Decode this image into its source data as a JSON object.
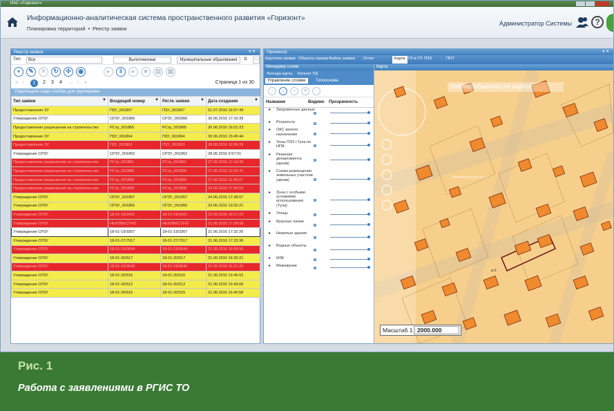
{
  "window": {
    "title": "ИАС «Горизонт»"
  },
  "header": {
    "title": "Информационно-аналитическая система пространственного развития «Горизонт»",
    "breadcrumb": [
      "Планировка территорий",
      "Реестр заявок"
    ],
    "user": "Администратор Системы"
  },
  "left_panel": {
    "title": "Реестр заявок",
    "filter_label": "Тип:",
    "filter_value": "Все",
    "done_button": "Выполненные",
    "mun_button": "Муниципальные образования",
    "pages": [
      "1",
      "2",
      "3",
      "4"
    ],
    "page_info": "Страница 1 из 30",
    "group_hint": "Перетащите сюда столбец для группировки",
    "columns": [
      "Тип заявки",
      "Входящий номер",
      "Рег.№ заявки",
      "Дата создания"
    ],
    "rows": [
      {
        "color": "yellow",
        "cells": [
          "Предоставление ЗУ",
          "П3У_001867",
          "П3У_001867",
          "01.07.2016 16:57:49"
        ]
      },
      {
        "color": "white",
        "cells": [
          "Утверждение СРЗУ",
          "СРЗУ_001866",
          "СРЗУ_001866",
          "30.06.2016 17:16:39"
        ]
      },
      {
        "color": "yellow",
        "cells": [
          "Предоставление разрешения на строительство",
          "РСтр_001865",
          "РСтр_001865",
          "30.06.2016 16:01:23"
        ]
      },
      {
        "color": "yellow",
        "cells": [
          "Предоставление ЗУ",
          "П3У_001864",
          "П3У_001864",
          "30.06.2016 15:45:44"
        ]
      },
      {
        "color": "red",
        "cells": [
          "Предоставление ЗУ",
          "П3У_001863",
          "П3У_001863",
          "28.06.2016 12:56:29"
        ]
      },
      {
        "color": "white",
        "cells": [
          "Утверждение СРЗУ",
          "СРЗУ_001862",
          "СРЗУ_001862",
          "28.06.2016 9:57:01"
        ]
      },
      {
        "color": "red",
        "cells": [
          "Предоставление разрешения на строительство",
          "РСтр_001861",
          "РСтр_001861",
          "27.06.2016 17:14:33"
        ]
      },
      {
        "color": "red",
        "cells": [
          "Предоставление разрешения на строительство",
          "РСтр_001860",
          "РСтр_001860",
          "27.06.2016 12:52:41"
        ]
      },
      {
        "color": "red",
        "cells": [
          "Предоставление разрешения на строительство",
          "РСтр_001859",
          "РСтр_001859",
          "27.06.2016 11:29:37"
        ]
      },
      {
        "color": "red",
        "cells": [
          "Предоставление разрешения на строительство",
          "РСтр_001858",
          "РСтр_001858",
          "24.06.2016 17:30:03"
        ]
      },
      {
        "color": "yellow",
        "cells": [
          "Утверждение СРЗУ",
          "СРЗУ_001857",
          "СРЗУ_001857",
          "24.06.2016 17:28:07"
        ]
      },
      {
        "color": "yellow",
        "cells": [
          "Утверждение СРЗУ",
          "СРЗУ_001855",
          "СРЗУ_001855",
          "23.06.2016 19:32:21"
        ]
      },
      {
        "color": "red",
        "cells": [
          "Утверждение СРЗУ",
          "18-01-19/3421",
          "18-01-19/3421",
          "22.06.2016 18:17:23"
        ]
      },
      {
        "color": "red",
        "cells": [
          "Утверждение СРЗУ",
          "НЕИЗВЕСТНО",
          "НЕИЗВЕСТНО",
          "21.06.2016 17:39:08"
        ]
      },
      {
        "color": "selected",
        "cells": [
          "Утверждение СРЗУ",
          "18-01-19/3307",
          "18-01-19/3307",
          "21.06.2016 17:32:26"
        ]
      },
      {
        "color": "yellow",
        "cells": [
          "Утверждение СРЗУ",
          "18-01-27/7917",
          "18-01-27/7917",
          "21.06.2016 17:23:36"
        ]
      },
      {
        "color": "red",
        "cells": [
          "Утверждение СРЗУ",
          "18-01-19/3044",
          "18-01-19/3044",
          "21.06.2016 16:55:56"
        ]
      },
      {
        "color": "yellow",
        "cells": [
          "Утверждение СРЗУ",
          "18-01-20/517",
          "18-01-20/517",
          "21.06.2016 16:26:21"
        ]
      },
      {
        "color": "red",
        "cells": [
          "Утверждение СРЗУ",
          "18-01-19/3040",
          "18-01-19/3040",
          "21.06.2016 16:21:22"
        ]
      },
      {
        "color": "yellow",
        "cells": [
          "Утверждение СРЗУ",
          "18-01-20/516",
          "18-01-20/516",
          "21.06.2016 15:45:02"
        ]
      },
      {
        "color": "yellow",
        "cells": [
          "Утверждение СРЗУ",
          "18-01-20/512",
          "18-01-20/512",
          "21.06.2016 15:43:06"
        ]
      },
      {
        "color": "yellow",
        "cells": [
          "Утверждение СРЗУ",
          "18-01-20/515",
          "18-01-20/515",
          "21.06.2016 15:40:58"
        ]
      }
    ]
  },
  "right_panel": {
    "title": "Просмотр",
    "tabs": [
      "Карточка заявки",
      "Объекты заявки",
      "Файлы заявки",
      "Отчет",
      "Карта",
      "СТП и ГП",
      "ПЗЗ",
      "ППТ"
    ],
    "active_tab": "Карта",
    "layer_manager": {
      "title": "Менеджер слоев",
      "sub_tabs": [
        "Легенда карты",
        "Каталог ПД"
      ],
      "tabs": [
        "Управление слоями",
        "Топооснова"
      ],
      "columns": [
        "Название",
        "Видимо",
        "Прозрачность"
      ],
      "layers": [
        "Загруженные данные",
        "Росреестр",
        "ОКС жилого назначения",
        "Зоны ПЗЗ г.Тула по НПА",
        "Решения департамента (архив)",
        "Схема размещения земельных участков (архив)",
        "Зона с особыми условиями использования (Тула)",
        "Улицы",
        "Красные линии",
        "Нежилые здания",
        "Водные объекты",
        "МЗК",
        "Межевание"
      ]
    },
    "map": {
      "title": "Карта",
      "search_placeholder": "Найти объекты на карте",
      "scale_label": "Масштаб 1 :",
      "scale_value": "2000.000",
      "lot_label": "Земельный участок: 1",
      "marker_label": "ж.5"
    }
  },
  "caption": {
    "figure": "Рис. 1",
    "text": "Работа с заявлениями в РГИС ТО"
  },
  "colors": {
    "yellow": "#f4ec4a",
    "red": "#e7272b",
    "accent": "#3a7cc2",
    "map": "#f7cf8c",
    "building": "#f08a2e"
  }
}
